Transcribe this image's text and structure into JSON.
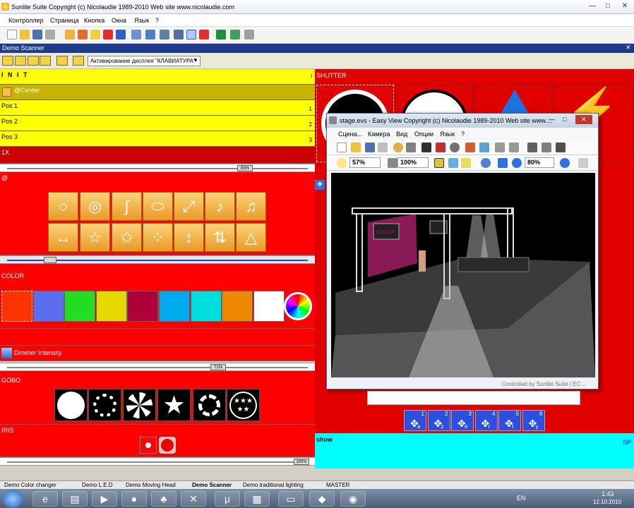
{
  "window": {
    "title": "Sunlite Suite    Copyright (c) Nicolaudie 1989-2010    Web site www.nicolaudie.com",
    "min": "—",
    "max": "□",
    "close": "✕"
  },
  "menu": [
    "Контроллер",
    "Страница",
    "Кнопка",
    "Окна",
    "Язык",
    "?"
  ],
  "demo_scanner": {
    "title": "Demo Scanner",
    "display_select": "Активирование дисплея \"КЛАВИАТУРА\""
  },
  "left": {
    "init": "I N I T",
    "init_right": "i",
    "center": "@Center",
    "positions": [
      {
        "label": "Pos 1",
        "num": "1"
      },
      {
        "label": "Pos 2",
        "num": "2"
      },
      {
        "label": "Pos 3",
        "num": "3"
      }
    ],
    "speed_label": "1X",
    "speed_value": "83%",
    "effects_label": "@",
    "color_label": "COLOR",
    "dimmer_label": "Dimmer Intensity",
    "dimmer_value": "71%",
    "gobo_label": "GOBO",
    "iris_label": "IRIS",
    "iris_value": "100%"
  },
  "colors": [
    "#ff3300",
    "#5a6cf0",
    "#22dd22",
    "#e6d800",
    "#b0003a",
    "#00aaee",
    "#00dddd",
    "#ee8800",
    "#ffffff"
  ],
  "shutter_label": "SHUTTER",
  "easy_view": {
    "title": "stage.evs - Easy View    Copyright (c) Nicolaudie 1989-2010    Web site www....",
    "menu": [
      "Сцена...",
      "Камера",
      "Вид",
      "Опции",
      "Язык",
      "?"
    ],
    "zoom1": "57%",
    "zoom2": "100%",
    "zoom3": "80%",
    "screen_text": "SCREEN",
    "status": "Controlled by Sunlite Suite | EC..."
  },
  "pos_buttons": [
    {
      "n": "1",
      "k": "a"
    },
    {
      "n": "2",
      "k": "z"
    },
    {
      "n": "3",
      "k": "e"
    },
    {
      "n": "4",
      "k": "r"
    },
    {
      "n": "5",
      "k": "t"
    },
    {
      "n": "6",
      "k": "y"
    }
  ],
  "show": {
    "label": "show",
    "right": "SP"
  },
  "tabs": [
    "Demo Color changer",
    "Demo L.E.D",
    "Demo Moving Head",
    "Demo Scanner",
    "Demo traditional lighting",
    "MASTER"
  ],
  "tray": {
    "lang": "EN",
    "time": "1:43",
    "date": "12.10.2010"
  }
}
